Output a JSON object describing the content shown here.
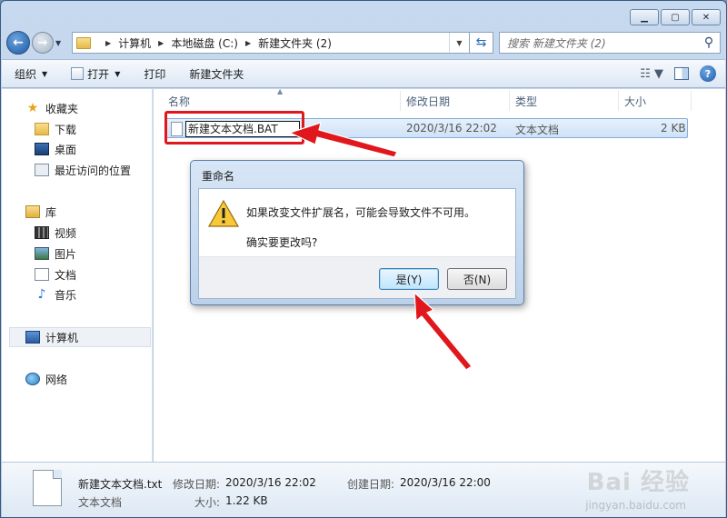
{
  "window": {
    "caption": {
      "minimize_icon": "minimize-icon",
      "maximize_icon": "maximize-icon",
      "close_icon": "close-icon"
    }
  },
  "address": {
    "breadcrumbs": [
      "计算机",
      "本地磁盘 (C:)",
      "新建文件夹 (2)"
    ],
    "search_placeholder": "搜索 新建文件夹 (2)"
  },
  "commandbar": {
    "organize": "组织",
    "open": "打开",
    "print": "打印",
    "new_folder": "新建文件夹"
  },
  "sidebar": {
    "favorites": "收藏夹",
    "downloads": "下载",
    "desktop": "桌面",
    "recent": "最近访问的位置",
    "libraries": "库",
    "videos": "视频",
    "pictures": "图片",
    "documents": "文档",
    "music": "音乐",
    "computer": "计算机",
    "network": "网络"
  },
  "columns": {
    "name": "名称",
    "modified": "修改日期",
    "type": "类型",
    "size": "大小"
  },
  "file": {
    "rename_value": "新建文本文档.BAT",
    "modified": "2020/3/16 22:02",
    "type": "文本文档",
    "size": "2 KB"
  },
  "dialog": {
    "title": "重命名",
    "message": "如果改变文件扩展名，可能会导致文件不可用。",
    "question": "确实要更改吗?",
    "yes": "是(Y)",
    "no": "否(N)"
  },
  "details": {
    "filename": "新建文本文档.txt",
    "filetype": "文本文档",
    "modified_label": "修改日期:",
    "modified_value": "2020/3/16 22:02",
    "created_label": "创建日期:",
    "created_value": "2020/3/16 22:00",
    "size_label": "大小:",
    "size_value": "1.22 KB"
  },
  "watermark": {
    "logo": "Bai 经验",
    "url": "jingyan.baidu.com"
  },
  "colors": {
    "highlight_red": "#e0171d",
    "selection_blue": "#cfe2f7"
  }
}
